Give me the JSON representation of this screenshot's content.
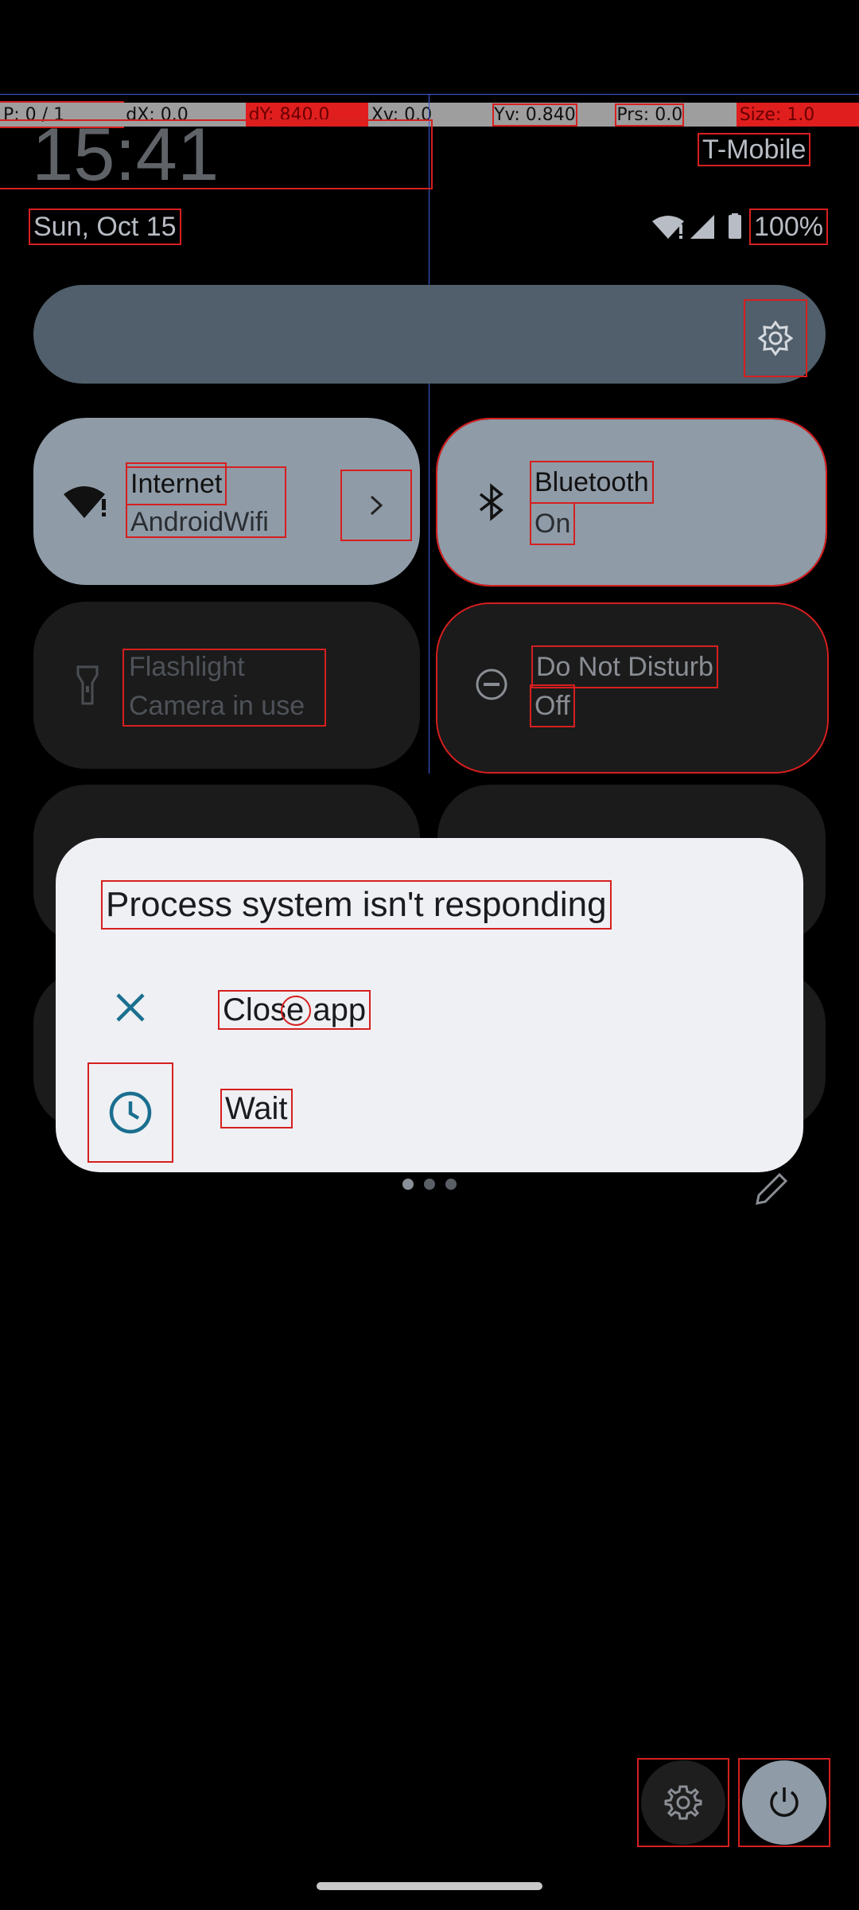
{
  "debug": {
    "pointer": "P: 0 / 1",
    "dx": "dX: 0.0",
    "dy": "dY: 840.0",
    "xv": "Xv: 0.0",
    "yv": "Yv: 0.840",
    "prs": "Prs: 0.0",
    "size": "Size: 1.0"
  },
  "status": {
    "time": "15:41",
    "carrier": "T-Mobile",
    "date": "Sun, Oct 15",
    "battery": "100%"
  },
  "tiles": {
    "internet": {
      "title": "Internet",
      "subtitle": "AndroidWifi"
    },
    "bluetooth": {
      "title": "Bluetooth",
      "subtitle": "On"
    },
    "flashlight": {
      "title": "Flashlight",
      "subtitle": "Camera in use"
    },
    "dnd": {
      "title": "Do Not Disturb",
      "subtitle": "Off"
    }
  },
  "dialog": {
    "title": "Process system isn't responding",
    "close_label": "Close app",
    "wait_label": "Wait"
  },
  "colors": {
    "accent": "#1a6f8f",
    "tile_on": "#8f9ba7",
    "tile_off": "#1b1b1b",
    "highlight_box": "#d61f1f"
  },
  "icons": {
    "brightness": "brightness-icon",
    "wifi": "wifi-alert-icon",
    "bluetooth": "bluetooth-icon",
    "flashlight": "flashlight-icon",
    "dnd": "minus-circle-icon",
    "close": "close-icon",
    "wait": "clock-icon",
    "edit": "pencil-icon",
    "settings": "gear-icon",
    "power": "power-icon"
  }
}
